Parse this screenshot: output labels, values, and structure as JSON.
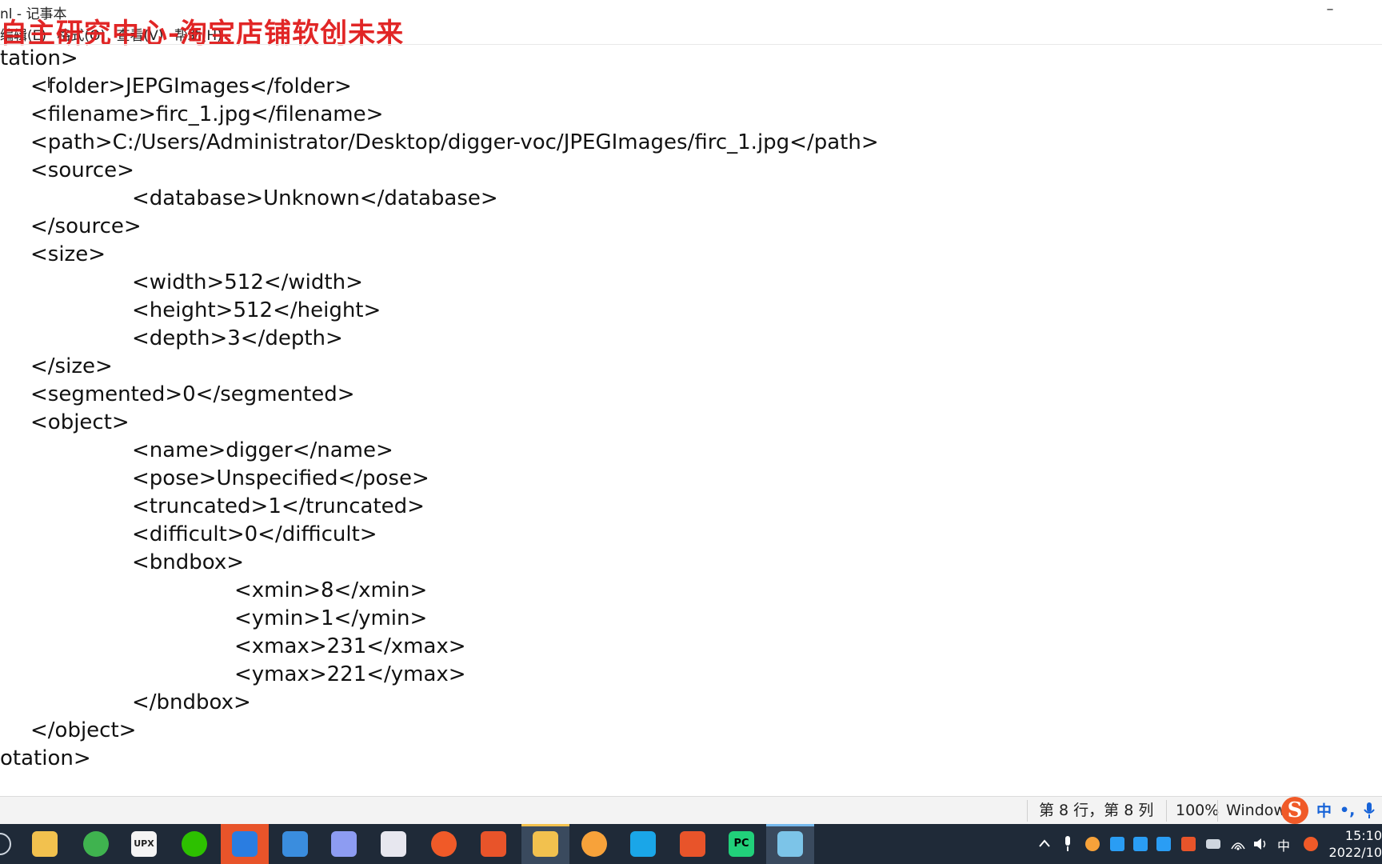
{
  "window": {
    "title": "nl - 记事本",
    "minimize_glyph": "–"
  },
  "watermark": "自主研究中心-淘宝店铺软创未来",
  "menu": [
    "编辑(E)",
    "格式(O)",
    "查看(V)",
    "帮助(H)"
  ],
  "lines": [
    "tation>",
    "    <folder>JEPGImages</folder>",
    "    <filename>firc_1.jpg</filename>",
    "    <path>C:/Users/Administrator/Desktop/digger-voc/JPEGImages/firc_1.jpg</path>",
    "    <source>",
    "        <database>Unknown</database>",
    "    </source>",
    "    <size>",
    "        <width>512</width>",
    "        <height>512</height>",
    "        <depth>3</depth>",
    "    </size>",
    "    <segmented>0</segmented>",
    "    <object>",
    "        <name>digger</name>",
    "        <pose>Unspecified</pose>",
    "        <truncated>1</truncated>",
    "        <difficult>0</difficult>",
    "        <bndbox>",
    "            <xmin>8</xmin>",
    "            <ymin>1</ymin>",
    "            <xmax>231</xmax>",
    "            <ymax>221</ymax>",
    "        </bndbox>",
    "    </object>",
    "otation>"
  ],
  "status": {
    "position": "第 8 行，第 8 列",
    "zoom": "100%",
    "line_ending": "Window"
  },
  "ime": {
    "logo": "S",
    "mode": "中",
    "punct": "•,"
  },
  "taskbar": {
    "upx_label": "UPX",
    "pc_label": "PC",
    "tray_lang": "中",
    "time": "15:10",
    "date": "2022/10"
  },
  "colors": {
    "watermark": "#e01b1b",
    "taskbar": "#1f2a38",
    "ime_blue": "#1763d8"
  }
}
